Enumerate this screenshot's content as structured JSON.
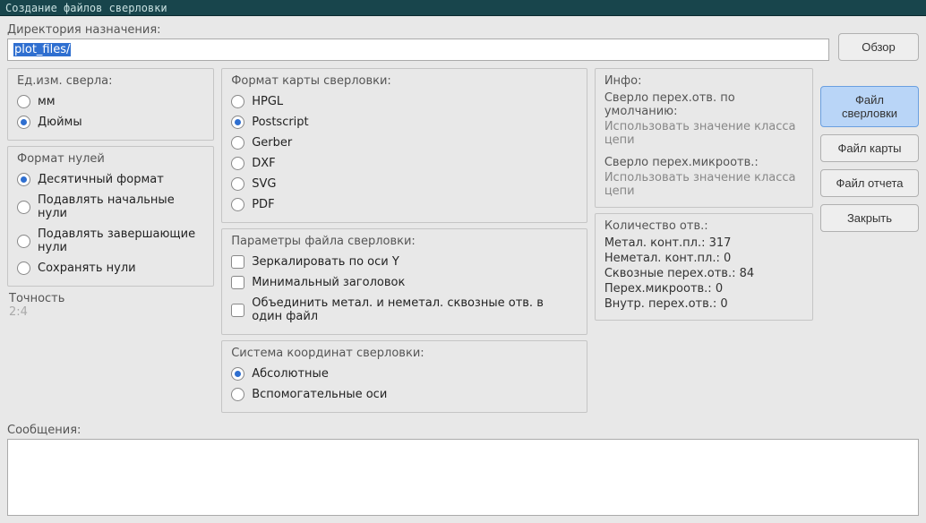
{
  "title": "Создание файлов сверловки",
  "dir": {
    "label": "Директория назначения:",
    "value": "plot_files/"
  },
  "browse": "Обзор",
  "units": {
    "title": "Ед.изм. сверла:",
    "mm": "мм",
    "inch": "Дюймы"
  },
  "zeros": {
    "title": "Формат нулей",
    "decimal": "Десятичный формат",
    "suppress_leading": "Подавлять начальные нули",
    "suppress_trailing": "Подавлять завершающие нули",
    "keep": "Сохранять нули"
  },
  "precision": {
    "title": "Точность",
    "value": "2:4"
  },
  "format": {
    "title": "Формат карты сверловки:",
    "hpgl": "HPGL",
    "postscript": "Postscript",
    "gerber": "Gerber",
    "dxf": "DXF",
    "svg": "SVG",
    "pdf": "PDF"
  },
  "params": {
    "title": "Параметры файла сверловки:",
    "mirror": "Зеркалировать по оси Y",
    "minhdr": "Минимальный заголовок",
    "merge": "Объединить метал. и неметал. сквозные отв. в один файл"
  },
  "coord": {
    "title": "Система координат сверловки:",
    "abs": "Абсолютные",
    "aux": "Вспомогательные оси"
  },
  "info": {
    "title": "Инфо:",
    "via_label": "Сверло перех.отв. по умолчанию:",
    "via_val": "Использовать значение класса цепи",
    "uvia_label": "Сверло перех.микроотв.:",
    "uvia_val": "Использовать значение класса цепи",
    "count_label": "Количество отв.:",
    "plated": "Метал. конт.пл.: 317",
    "nonplated": "Неметал. конт.пл.: 0",
    "through": "Сквозные перех.отв.: 84",
    "micro": "Перех.микроотв.: 0",
    "buried": "Внутр. перех.отв.: 0"
  },
  "buttons": {
    "drill": "Файл сверловки",
    "map": "Файл карты",
    "report": "Файл отчета",
    "close": "Закрыть"
  },
  "messages_label": "Сообщения:"
}
